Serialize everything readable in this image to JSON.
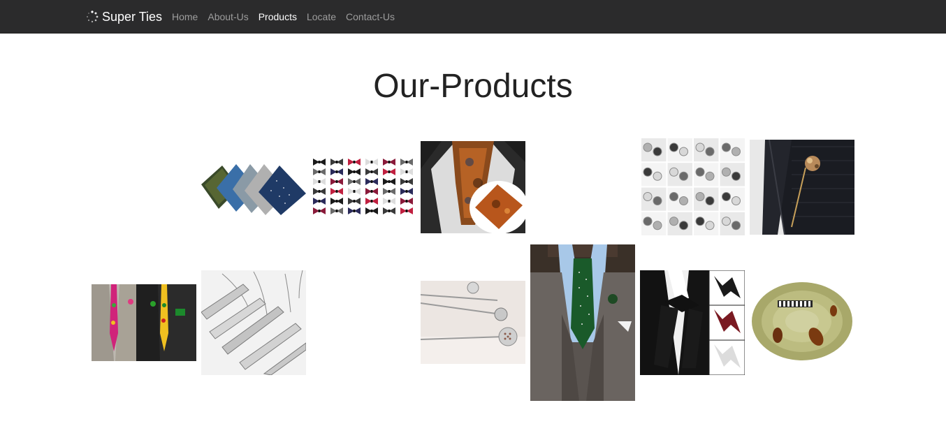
{
  "navbar": {
    "brand": "Super Ties",
    "brand_icon": "spinner-icon",
    "items": [
      {
        "label": "Home",
        "active": false
      },
      {
        "label": "About-Us",
        "active": false
      },
      {
        "label": "Products",
        "active": true
      },
      {
        "label": "Locate",
        "active": false
      },
      {
        "label": "Contact-Us",
        "active": false
      }
    ]
  },
  "main": {
    "title": "Our-Products"
  },
  "products": [
    "pocket-squares",
    "bow-ties-grid",
    "paisley-cravat",
    "cufflinks-grid",
    "lapel-pin-on-suit",
    "african-print-ties",
    "tie-clips",
    "stick-pins",
    "green-dot-tie-outfit",
    "self-tie-bow-ties",
    "music-print-tie"
  ],
  "colors": {
    "navbar_bg": "#2b2b2c",
    "nav_text": "#9d9d9d",
    "nav_active": "#ffffff"
  }
}
